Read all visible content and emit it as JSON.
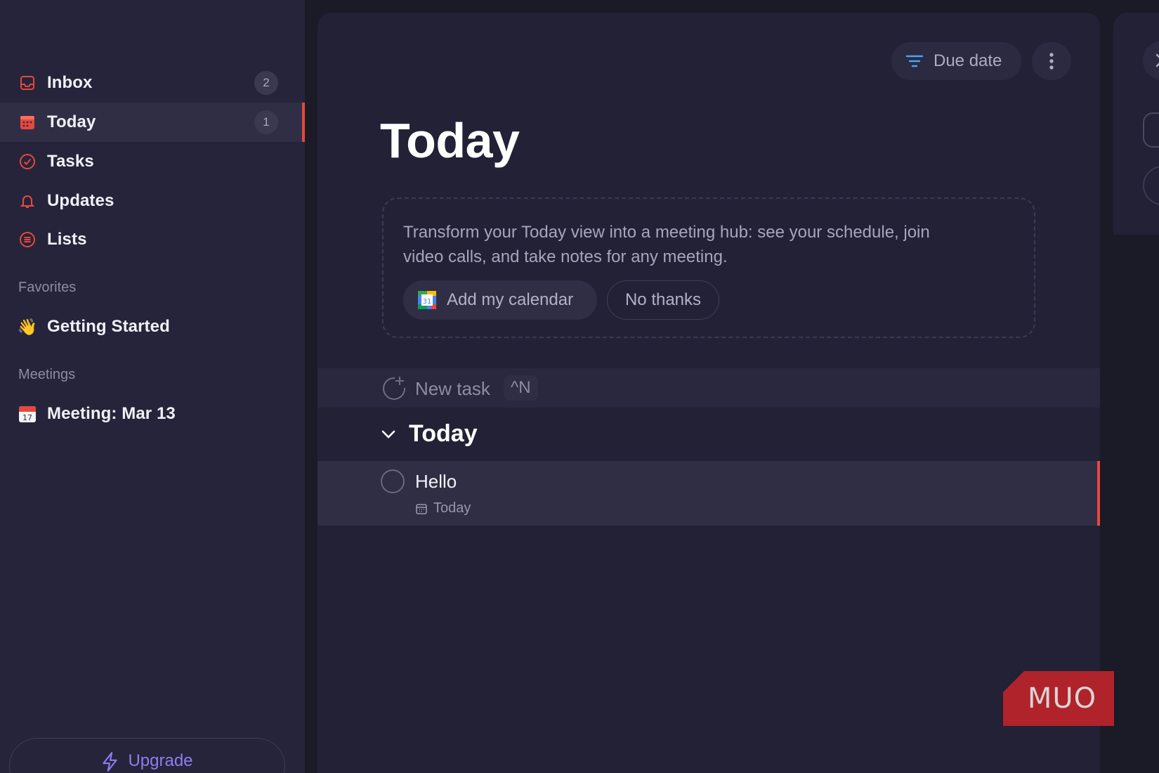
{
  "sidebar": {
    "nav": [
      {
        "label": "Inbox",
        "count": "2",
        "icon": "inbox-icon"
      },
      {
        "label": "Today",
        "count": "1",
        "icon": "calendar-today-icon",
        "active": true
      },
      {
        "label": "Tasks",
        "icon": "check-circle-icon"
      },
      {
        "label": "Updates",
        "icon": "bell-icon"
      },
      {
        "label": "Lists",
        "icon": "list-icon"
      }
    ],
    "favorites_title": "Favorites",
    "favorites": [
      {
        "label": "Getting Started",
        "icon": "waving-hand-icon",
        "emoji": "👋"
      }
    ],
    "meetings_title": "Meetings",
    "meetings": [
      {
        "label": "Meeting: Mar 13",
        "icon": "calendar-emoji-icon"
      }
    ],
    "upgrade_label": "Upgrade"
  },
  "header": {
    "sort_label": "Due date",
    "title": "Today"
  },
  "promo": {
    "text": "Transform your Today view into a meeting hub: see your schedule, join video calls, and take notes for any meeting.",
    "primary_label": "Add my calendar",
    "secondary_label": "No thanks",
    "calendar_icon_text": "31"
  },
  "new_task": {
    "label": "New task",
    "shortcut": "^N"
  },
  "groups": [
    {
      "title": "Today",
      "tasks": [
        {
          "title": "Hello",
          "due": "Today"
        }
      ]
    }
  ],
  "watermark": "MUO",
  "colors": {
    "accent": "#e5483d",
    "upgrade": "#8f7cf0",
    "sort_icon": "#4aa3f5"
  }
}
